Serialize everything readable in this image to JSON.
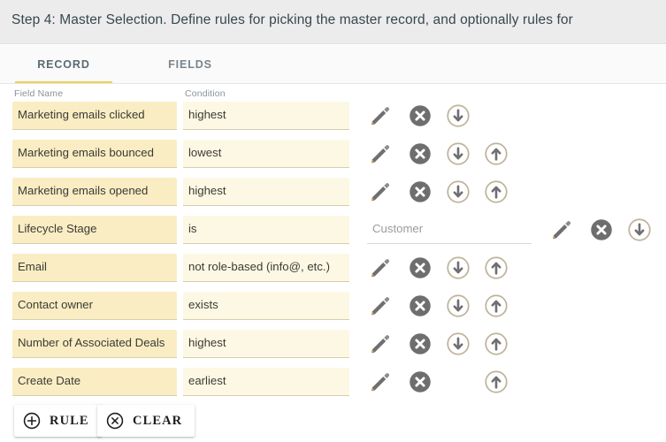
{
  "header": {
    "title": "Step 4: Master Selection. Define rules for picking the master record, and optionally rules for"
  },
  "tabs": [
    {
      "label": "RECORD",
      "active": true
    },
    {
      "label": "FIELDS",
      "active": false
    }
  ],
  "columns": {
    "field_name_label": "Field Name",
    "condition_label": "Condition"
  },
  "colors": {
    "accent_underline": "#f2ce56",
    "field_name_bg": "#faedc3",
    "condition_bg": "#fdf8e3",
    "header_bg": "#ececec",
    "delete_icon": "#6e6e6e",
    "pencil_tip": "#d9a15a"
  },
  "icons": {
    "edit": "pencil-icon",
    "delete": "close-circle-icon",
    "move_down": "arrow-down-circle-icon",
    "move_up": "arrow-up-circle-icon",
    "add": "plus-circle-icon",
    "clear": "x-circle-icon"
  },
  "rules": [
    {
      "field_name": "Marketing emails clicked",
      "condition": "highest",
      "value": null,
      "has_edit": true,
      "has_delete": true,
      "has_down": true,
      "has_up": false
    },
    {
      "field_name": "Marketing emails bounced",
      "condition": "lowest",
      "value": null,
      "has_edit": true,
      "has_delete": true,
      "has_down": true,
      "has_up": true
    },
    {
      "field_name": "Marketing emails opened",
      "condition": "highest",
      "value": null,
      "has_edit": true,
      "has_delete": true,
      "has_down": true,
      "has_up": true
    },
    {
      "field_name": "Lifecycle Stage",
      "condition": "is",
      "value": "Customer",
      "has_edit": true,
      "has_delete": true,
      "has_down": true,
      "has_up": false
    },
    {
      "field_name": "Email",
      "condition": "not role-based (info@, etc.)",
      "value": null,
      "has_edit": true,
      "has_delete": true,
      "has_down": true,
      "has_up": true
    },
    {
      "field_name": "Contact owner",
      "condition": "exists",
      "value": null,
      "has_edit": true,
      "has_delete": true,
      "has_down": true,
      "has_up": true
    },
    {
      "field_name": "Number of Associated Deals",
      "condition": "highest",
      "value": null,
      "has_edit": true,
      "has_delete": true,
      "has_down": true,
      "has_up": true
    },
    {
      "field_name": "Create Date",
      "condition": "earliest",
      "value": null,
      "has_edit": true,
      "has_delete": true,
      "has_down": false,
      "has_up": true
    }
  ],
  "bottom_actions": {
    "rule_label": "RULE",
    "clear_label": "CLEAR"
  }
}
